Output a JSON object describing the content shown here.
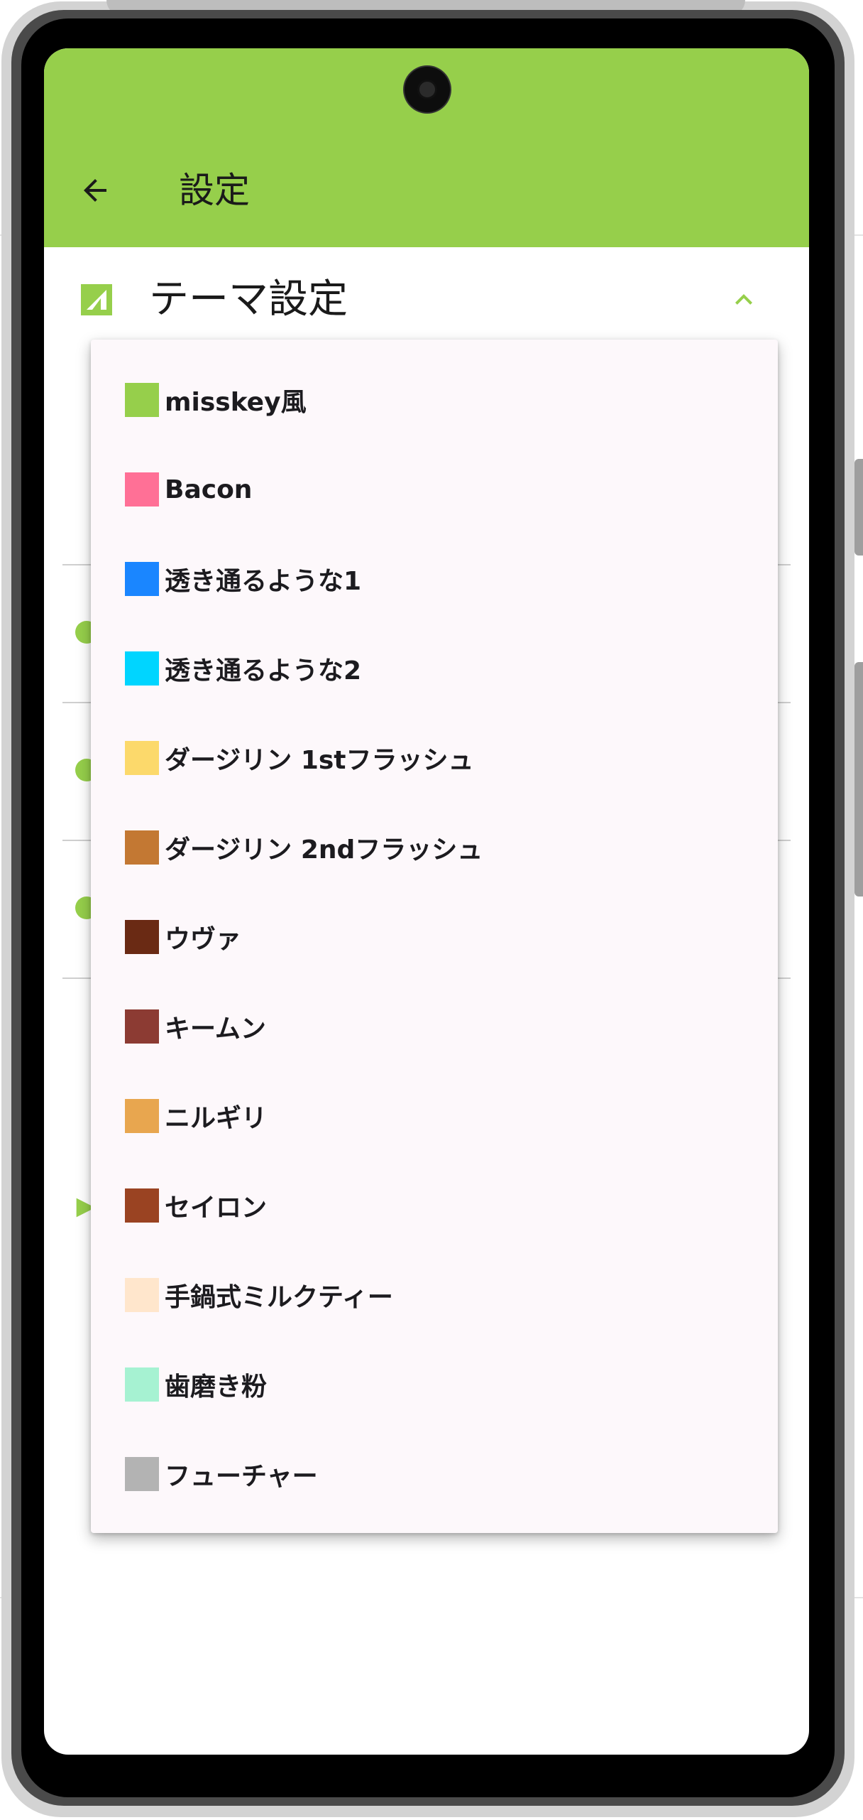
{
  "app_bar": {
    "title": "設定",
    "back_icon": "arrow-back-icon",
    "color": "#96cf4b"
  },
  "section": {
    "title": "テーマ設定",
    "icon": "theme-icon",
    "expand_icon": "chevron-up-icon",
    "accent": "#96cf4b"
  },
  "dropdown": {
    "options": [
      {
        "label": "misskey風",
        "color": "#96cf4b"
      },
      {
        "label": "Bacon",
        "color": "#ff7096"
      },
      {
        "label": "透き通るような1",
        "color": "#1a86ff"
      },
      {
        "label": "透き通るような2",
        "color": "#00d5ff"
      },
      {
        "label": "ダージリン 1stフラッシュ",
        "color": "#fcd96b"
      },
      {
        "label": "ダージリン 2ndフラッシュ",
        "color": "#c37833"
      },
      {
        "label": "ウヴァ",
        "color": "#6a2a14"
      },
      {
        "label": "キームン",
        "color": "#8c3b33"
      },
      {
        "label": "ニルギリ",
        "color": "#e8a64f"
      },
      {
        "label": "セイロン",
        "color": "#9a4322"
      },
      {
        "label": "手鍋式ミルクティー",
        "color": "#ffe6cc"
      },
      {
        "label": "歯磨き粉",
        "color": "#a6f2d2"
      },
      {
        "label": "フューチャー",
        "color": "#b3b3b3"
      }
    ]
  }
}
